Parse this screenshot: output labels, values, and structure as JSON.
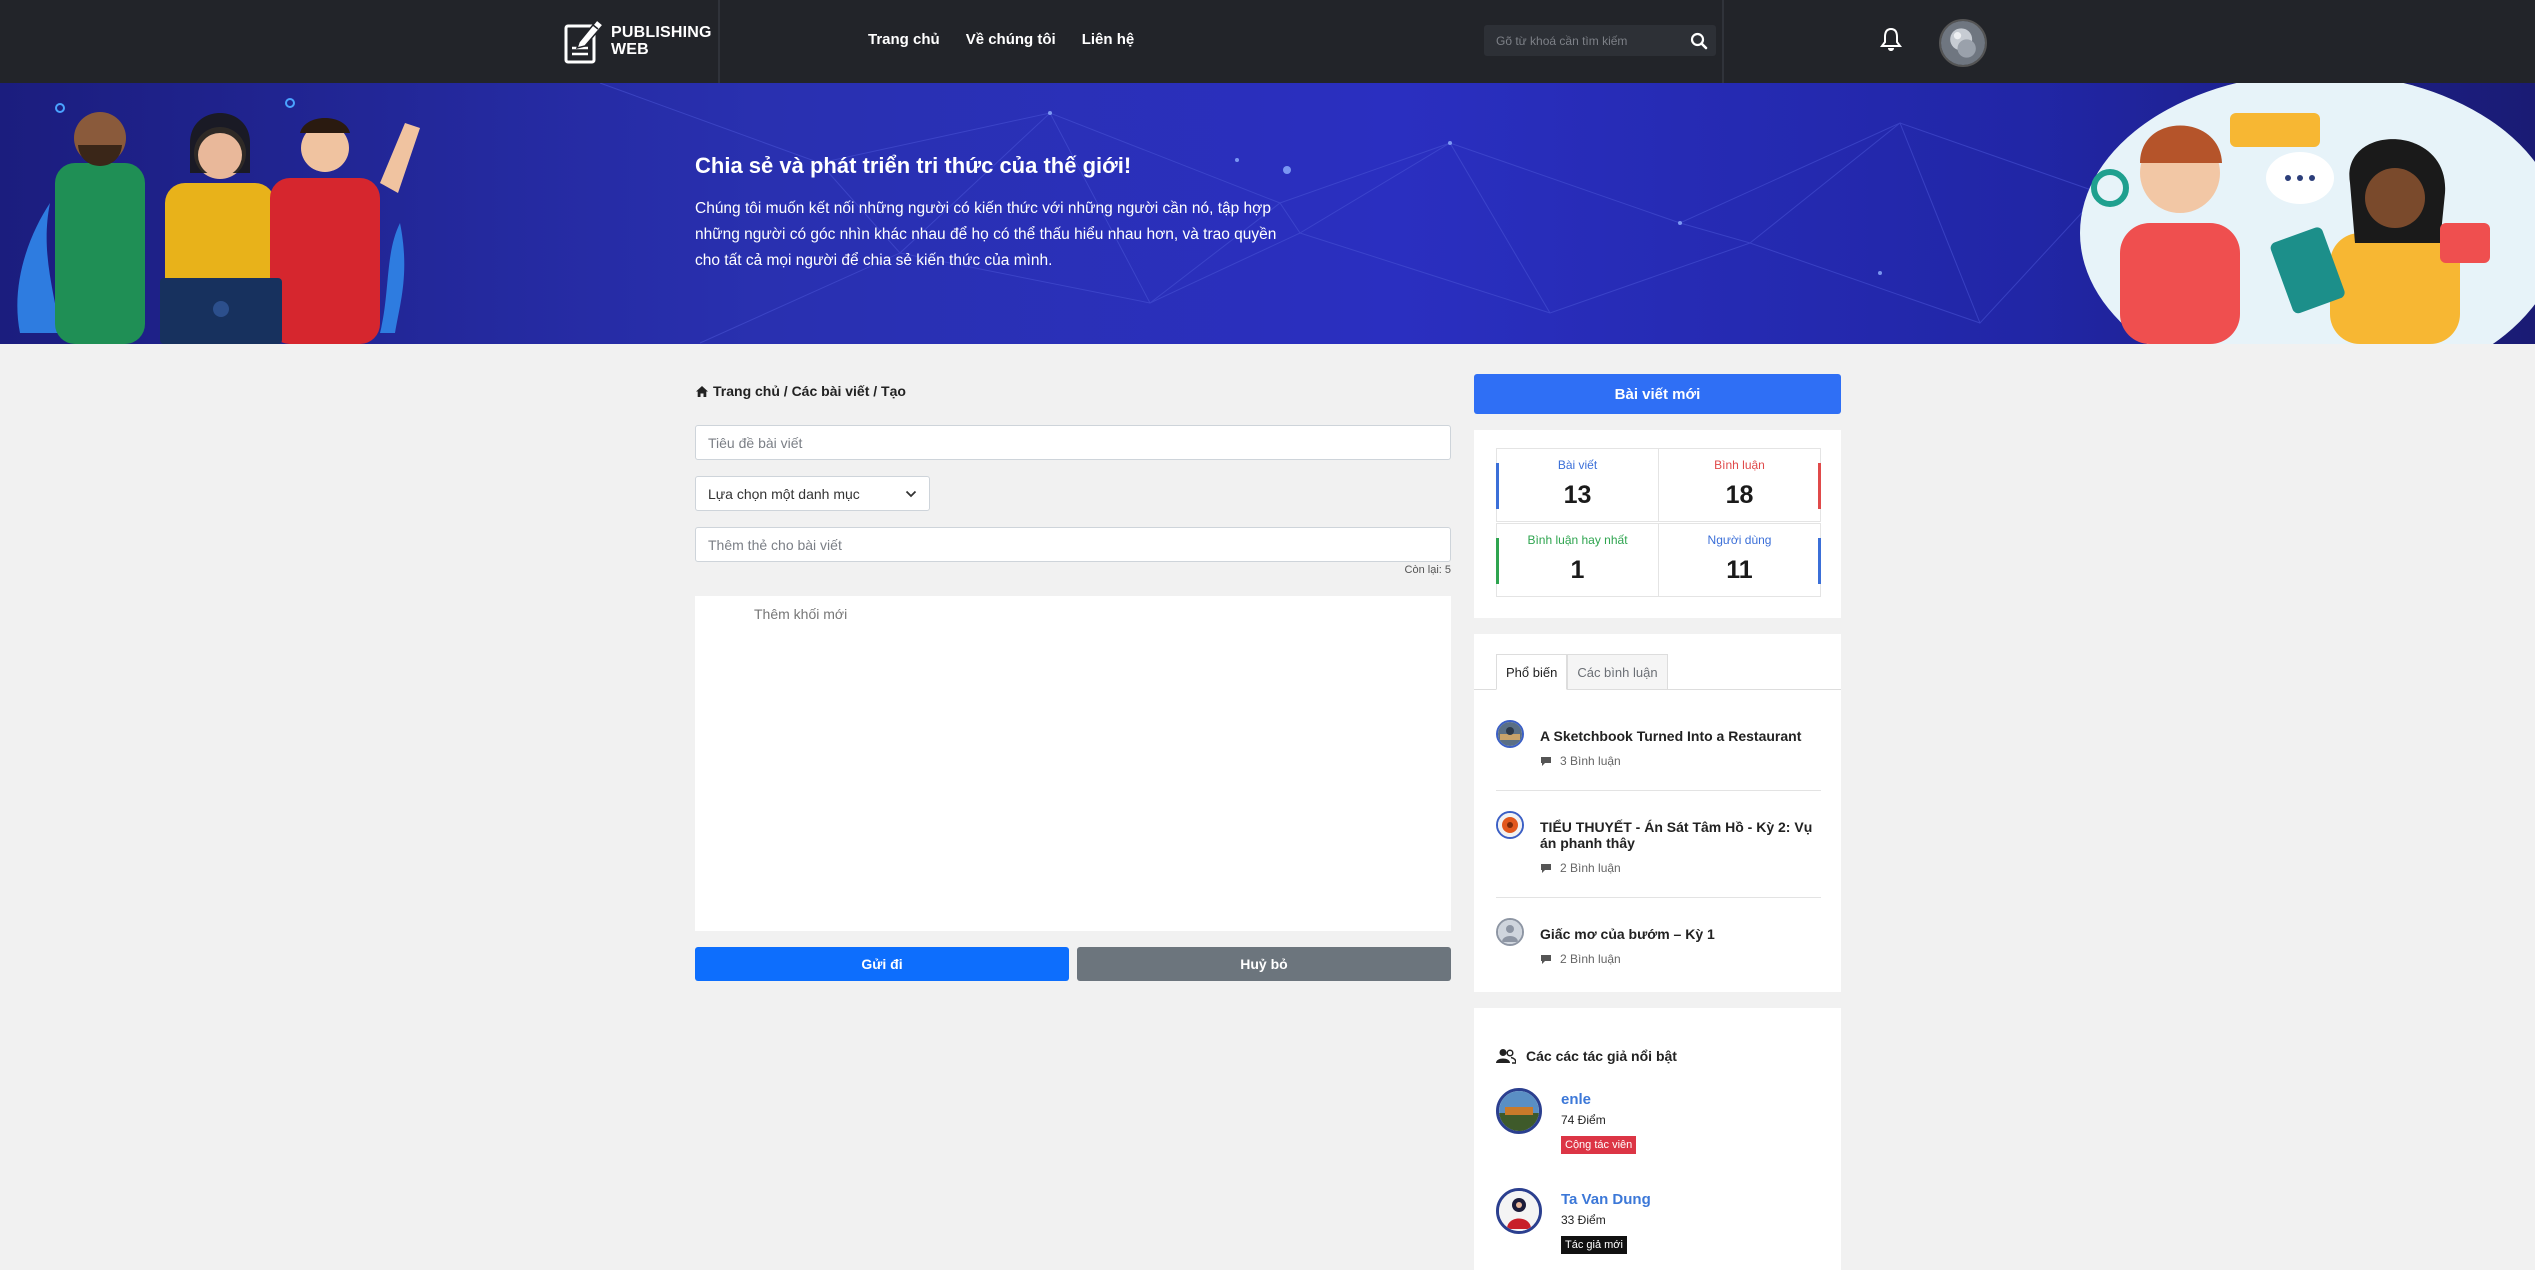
{
  "navbar": {
    "logo_line1": "PUBLISHING",
    "logo_line2": "WEB",
    "links": [
      "Trang chủ",
      "Về chúng tôi",
      "Liên hệ"
    ],
    "search_placeholder": "Gõ từ khoá cần tìm kiếm"
  },
  "hero": {
    "title": "Chia sẻ và phát triển tri thức của thế giới!",
    "description": "Chúng tôi muốn kết nối những người có kiến thức với những người cần nó, tập hợp những người có góc nhìn khác nhau để họ có thể thấu hiểu nhau hơn, và trao quyền cho tất cả mọi người để chia sẻ kiến thức của mình."
  },
  "breadcrumb": {
    "text": "Trang chủ / Các bài viết / Tạo"
  },
  "form": {
    "title_placeholder": "Tiêu đề bài viết",
    "category_placeholder": "Lựa chọn một danh mục",
    "tags_placeholder": "Thêm thẻ cho bài viết",
    "remaining": "Còn lại: 5",
    "editor_placeholder": "Thêm khối mới",
    "submit_label": "Gửi đi",
    "cancel_label": "Huỷ bỏ"
  },
  "sidebar": {
    "new_post_label": "Bài viết mới",
    "stats": [
      {
        "label": "Bài viết",
        "value": "13",
        "color": "#3b6fd8"
      },
      {
        "label": "Bình luận",
        "value": "18",
        "color": "#e04a4a"
      },
      {
        "label": "Bình luận hay nhất",
        "value": "1",
        "color": "#2ea44f"
      },
      {
        "label": "Người dùng",
        "value": "11",
        "color": "#3b6fd8"
      }
    ],
    "tabs": [
      "Phổ biến",
      "Các bình luận"
    ],
    "popular_posts": [
      {
        "title": "A Sketchbook Turned Into a Restaurant",
        "comments": "3 Bình luận"
      },
      {
        "title": "TIỂU THUYẾT - Án Sát Tâm Hồ - Kỳ 2: Vụ án phanh thây",
        "comments": "2 Bình luận"
      },
      {
        "title": "Giấc mơ của bướm – Kỳ 1",
        "comments": "2 Bình luận"
      }
    ],
    "authors_title": "Các các tác giả nổi bật",
    "authors": [
      {
        "name": "enle",
        "points": "74 Điểm",
        "badge": "Cộng tác viên",
        "badge_color": "#dc3545"
      },
      {
        "name": "Ta Van Dung",
        "points": "33 Điểm",
        "badge": "Tác giả mới",
        "badge_color": "#111111"
      }
    ]
  },
  "colors": {
    "navbar_bg": "#222429",
    "primary": "#0d6efd",
    "secondary": "#6c757d",
    "hero_bg": "#2a2fc0"
  }
}
